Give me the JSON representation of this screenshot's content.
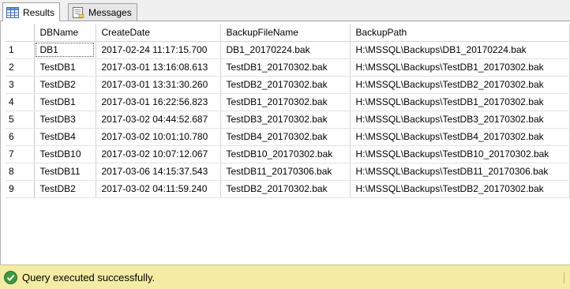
{
  "tabs": [
    {
      "label": "Results",
      "icon": "grid-icon",
      "active": true
    },
    {
      "label": "Messages",
      "icon": "messages-icon",
      "active": false
    }
  ],
  "grid": {
    "columns": [
      "",
      "DBName",
      "CreateDate",
      "BackupFileName",
      "BackupPath"
    ],
    "rows": [
      [
        "1",
        "DB1",
        "2017-02-24 11:17:15.700",
        "DB1_20170224.bak",
        "H:\\MSSQL\\Backups\\DB1_20170224.bak"
      ],
      [
        "2",
        "TestDB1",
        "2017-03-01 13:16:08.613",
        "TestDB1_20170302.bak",
        "H:\\MSSQL\\Backups\\TestDB1_20170302.bak"
      ],
      [
        "3",
        "TestDB2",
        "2017-03-01 13:31:30.260",
        "TestDB2_20170302.bak",
        "H:\\MSSQL\\Backups\\TestDB2_20170302.bak"
      ],
      [
        "4",
        "TestDB1",
        "2017-03-01 16:22:56.823",
        "TestDB1_20170302.bak",
        "H:\\MSSQL\\Backups\\TestDB1_20170302.bak"
      ],
      [
        "5",
        "TestDB3",
        "2017-03-02 04:44:52.687",
        "TestDB3_20170302.bak",
        "H:\\MSSQL\\Backups\\TestDB3_20170302.bak"
      ],
      [
        "6",
        "TestDB4",
        "2017-03-02 10:01:10.780",
        "TestDB4_20170302.bak",
        "H:\\MSSQL\\Backups\\TestDB4_20170302.bak"
      ],
      [
        "7",
        "TestDB10",
        "2017-03-02 10:07:12.067",
        "TestDB10_20170302.bak",
        "H:\\MSSQL\\Backups\\TestDB10_20170302.bak"
      ],
      [
        "8",
        "TestDB11",
        "2017-03-06 14:15:37.543",
        "TestDB11_20170306.bak",
        "H:\\MSSQL\\Backups\\TestDB11_20170306.bak"
      ],
      [
        "9",
        "TestDB2",
        "2017-03-02 04:11:59.240",
        "TestDB2_20170302.bak",
        "H:\\MSSQL\\Backups\\TestDB2_20170302.bak"
      ]
    ]
  },
  "status": {
    "text": "Query executed successfully.",
    "icon": "check-circle-icon",
    "color": "#f4eca4"
  }
}
